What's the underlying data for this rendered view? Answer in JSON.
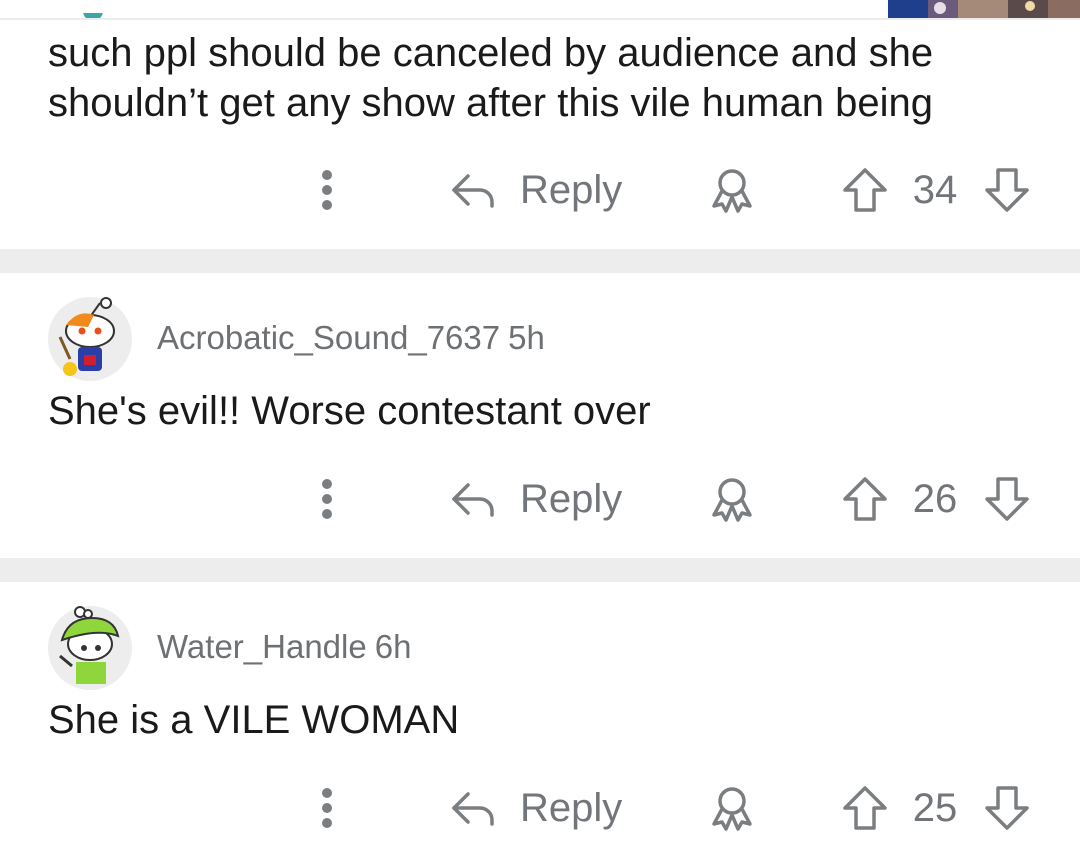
{
  "colors": {
    "text": "#1a1a1b",
    "meta": "#6e7174",
    "action": "#727579",
    "divider": "#ededed"
  },
  "actions": {
    "reply_label": "Reply",
    "icons": [
      "more-vertical-icon",
      "reply-arrow-icon",
      "award-icon",
      "upvote-arrow-icon",
      "downvote-arrow-icon"
    ]
  },
  "comments": [
    {
      "text_lines": [
        "such ppl should be canceled by audience and she",
        "shouldn’t get any show after this vile human being"
      ],
      "score": "34"
    },
    {
      "username": "Acrobatic_Sound_7637",
      "time": "5h",
      "text_lines": [
        "She's evil!! Worse contestant over"
      ],
      "score": "26"
    },
    {
      "username": "Water_Handle",
      "time": "6h",
      "text_lines": [
        "She is a VILE WOMAN"
      ],
      "score": "25"
    }
  ]
}
